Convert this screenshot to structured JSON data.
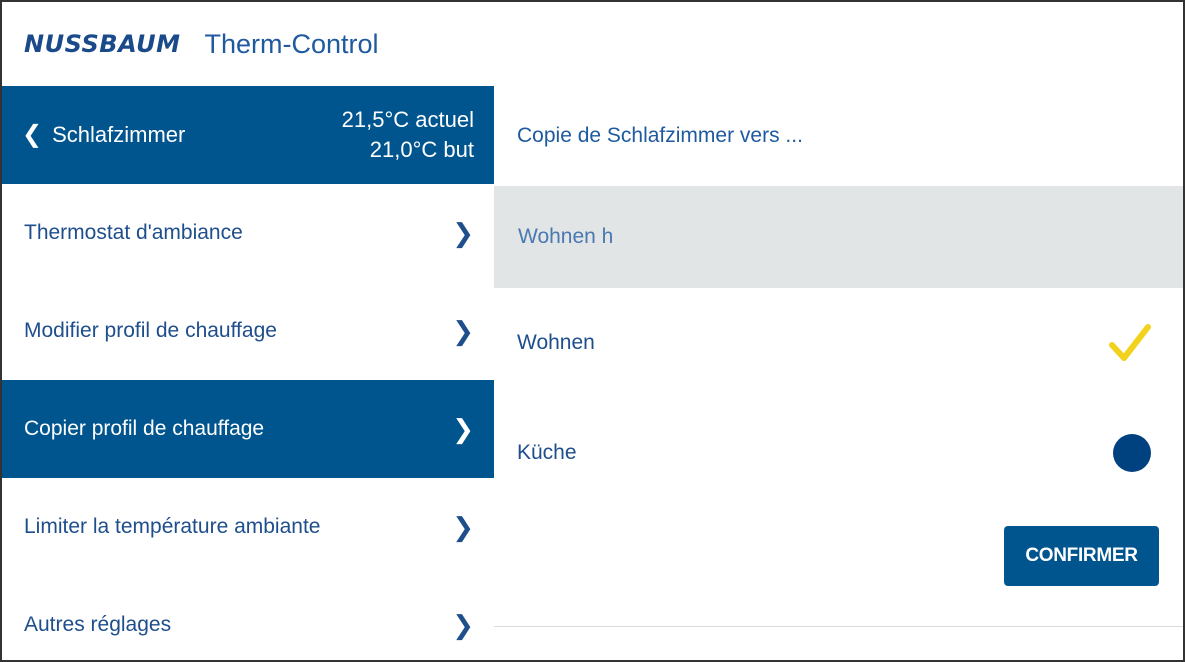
{
  "header": {
    "brand": "NUSSBAUM",
    "app_title": "Therm-Control"
  },
  "room": {
    "back_icon": "chevron-left-icon",
    "name": "Schlafzimmer",
    "current_temp": "21,5°C actuel",
    "target_temp": "21,0°C but"
  },
  "menu": {
    "items": [
      {
        "label": "Thermostat d'ambiance",
        "active": false
      },
      {
        "label": "Modifier profil de chauffage",
        "active": false
      },
      {
        "label": "Copier profil de chauffage",
        "active": true
      },
      {
        "label": "Limiter la température ambiante",
        "active": false
      },
      {
        "label": "Autres réglages",
        "active": false
      }
    ],
    "arrow_icon": "chevron-right-icon"
  },
  "copy": {
    "title": "Copie de Schlafzimmer vers ...",
    "search_value": "Wohnen h",
    "options": [
      {
        "label": "Wohnen",
        "state": "checked",
        "icon": "checkmark-icon"
      },
      {
        "label": "Küche",
        "state": "unchecked",
        "icon": "filled-circle-icon"
      }
    ],
    "confirm_label": "CONFIRMER"
  },
  "colors": {
    "primary": "#00558f",
    "text": "#1f4e8c",
    "check": "#f2d21c",
    "search_bg": "#e1e5e6"
  }
}
